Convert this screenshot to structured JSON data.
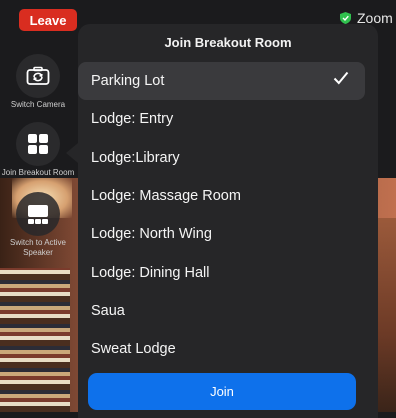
{
  "top_bar": {
    "leave_label": "Leave",
    "zoom_label": "Zoom",
    "shield_color": "#30c04e"
  },
  "controls": {
    "switch_camera": {
      "label": "Switch Camera",
      "icon": "switch-camera-icon"
    },
    "join_breakout": {
      "label": "Join Breakout Room",
      "icon": "grid-icon"
    },
    "active_speaker": {
      "label": "Switch to Active Speaker",
      "icon": "active-speaker-icon"
    }
  },
  "sheet": {
    "title": "Join Breakout Room",
    "rooms": [
      {
        "name": "Parking Lot",
        "selected": true
      },
      {
        "name": "Lodge: Entry",
        "selected": false
      },
      {
        "name": "Lodge:Library",
        "selected": false
      },
      {
        "name": "Lodge: Massage Room",
        "selected": false
      },
      {
        "name": "Lodge: North Wing",
        "selected": false
      },
      {
        "name": "Lodge: Dining Hall",
        "selected": false
      },
      {
        "name": "Saua",
        "selected": false
      },
      {
        "name": "Sweat Lodge",
        "selected": false
      }
    ],
    "join_label": "Join"
  },
  "colors": {
    "leave": "#d92d20",
    "join": "#0e71eb",
    "sheet_bg": "#262628"
  }
}
